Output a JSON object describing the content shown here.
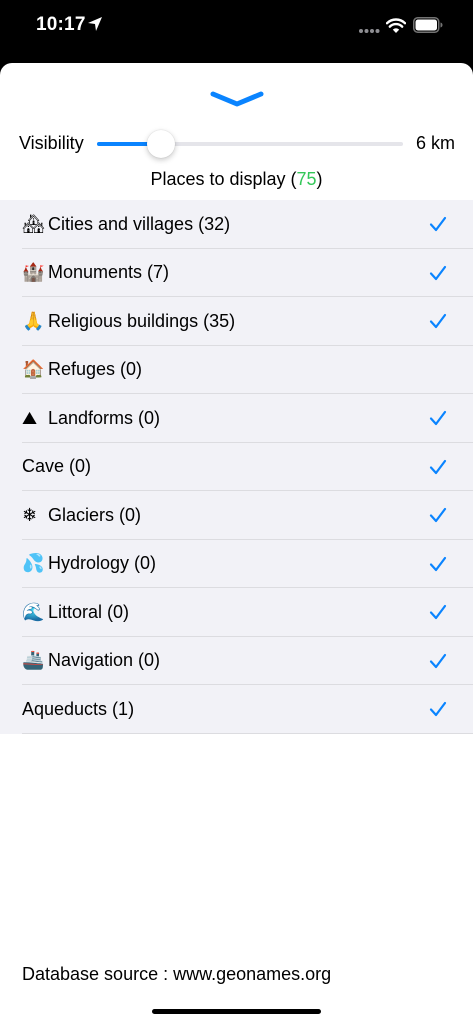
{
  "status_bar": {
    "time": "10:17",
    "icons": [
      "location-icon",
      "dots-icon",
      "wifi-icon",
      "battery-icon"
    ]
  },
  "sheet": {
    "handle_icon": "chevron-down-icon",
    "accent_color": "#0a84ff",
    "visibility": {
      "label": "Visibility",
      "slider_fraction": 0.21,
      "value_text": "6 km"
    },
    "places": {
      "prefix": "Places to display (",
      "count": "75",
      "suffix": ")",
      "count_color": "#34c759"
    },
    "categories": [
      {
        "emoji": "🏘",
        "label": "Cities and villages (32)",
        "checked": true
      },
      {
        "emoji": "🏰",
        "label": "Monuments (7)",
        "checked": true
      },
      {
        "emoji": "🙏",
        "label": "Religious buildings (35)",
        "checked": true
      },
      {
        "emoji": "🏠",
        "label": "Refuges (0)",
        "checked": false
      },
      {
        "emoji": "⛰",
        "label": "Landforms (0)",
        "checked": true
      },
      {
        "emoji": "",
        "label": "Cave (0)",
        "checked": true
      },
      {
        "emoji": "❄",
        "label": "Glaciers (0)",
        "checked": true
      },
      {
        "emoji": "💦",
        "label": "Hydrology (0)",
        "checked": true
      },
      {
        "emoji": "🌊",
        "label": "Littoral (0)",
        "checked": true
      },
      {
        "emoji": "🚢",
        "label": "Navigation (0)",
        "checked": true
      },
      {
        "emoji": "",
        "label": "Aqueducts (1)",
        "checked": true
      }
    ],
    "footer": "Database source : www.geonames.org"
  }
}
